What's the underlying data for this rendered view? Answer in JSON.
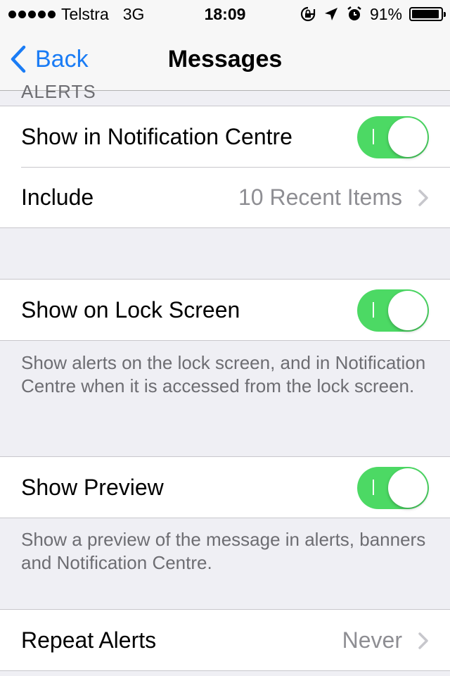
{
  "status_bar": {
    "carrier": "Telstra",
    "network": "3G",
    "time": "18:09",
    "battery": "91%",
    "battery_level": 0.91,
    "icons": [
      "rotation-lock-icon",
      "location-icon",
      "alarm-icon"
    ]
  },
  "nav": {
    "back_label": "Back",
    "title": "Messages"
  },
  "sections": {
    "alerts_header": "ALERTS",
    "show_in_nc": {
      "label": "Show in Notification Centre",
      "on": true
    },
    "include": {
      "label": "Include",
      "value": "10 Recent Items"
    },
    "lock_screen": {
      "label": "Show on Lock Screen",
      "on": true
    },
    "lock_screen_footer": "Show alerts on the lock screen, and in Notification Centre when it is accessed from the lock screen.",
    "show_preview": {
      "label": "Show Preview",
      "on": true
    },
    "show_preview_footer": "Show a preview of the message in alerts, banners and Notification Centre.",
    "repeat_alerts": {
      "label": "Repeat Alerts",
      "value": "Never"
    }
  },
  "colors": {
    "accent": "#1a7cf5",
    "toggle_on": "#4cd964",
    "background": "#efeff4"
  }
}
